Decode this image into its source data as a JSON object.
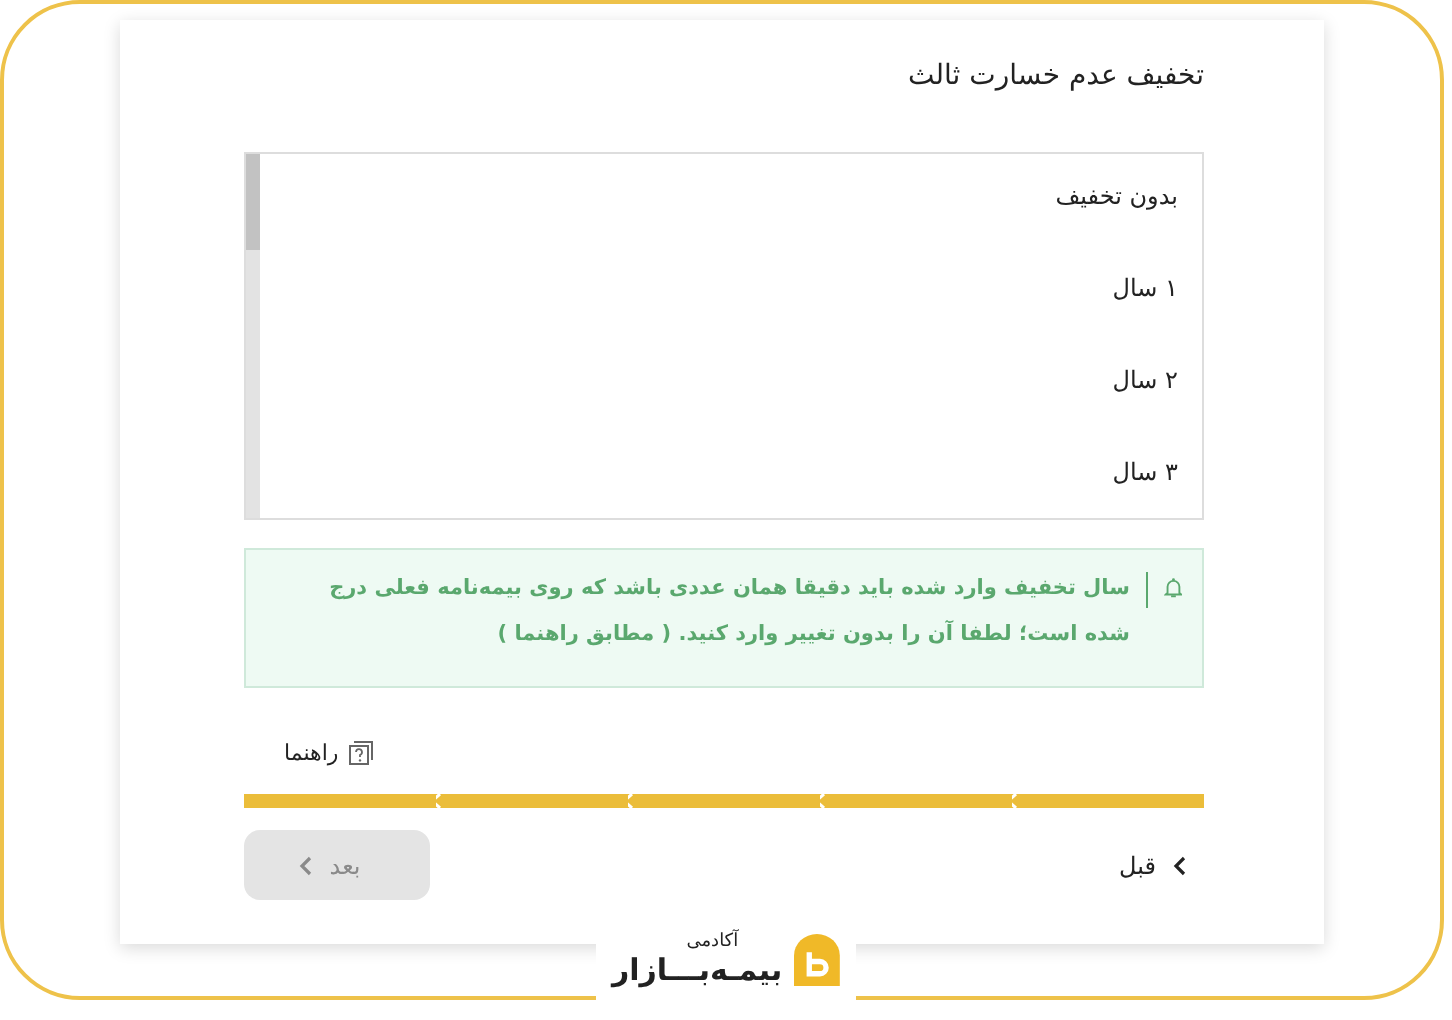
{
  "title": "تخفیف عدم خسارت ثالث",
  "options": [
    {
      "label": "بدون تخفیف",
      "selected": false
    },
    {
      "label": "۱ سال",
      "selected": false
    },
    {
      "label": "۲ سال",
      "selected": false
    },
    {
      "label": "۳ سال",
      "selected": false
    }
  ],
  "alert": {
    "text": "سال تخفیف وارد شده باید دقیقا همان عددی باشد که روی بیمه‌نامه فعلی درج شده است؛ لطفا آن را بدون تغییر وارد کنید. ( مطابق راهنما )"
  },
  "guide_link": "راهنما",
  "progress": [
    {
      "done": true
    },
    {
      "done": true
    },
    {
      "done": true
    },
    {
      "done": true
    },
    {
      "done": true
    }
  ],
  "buttons": [
    {
      "label": "قبل",
      "disabled": false
    },
    {
      "label": "بعد",
      "disabled": true
    }
  ],
  "logo": {
    "subtitle": "آکادمی",
    "name": "بیمـه‌بـــازار"
  }
}
